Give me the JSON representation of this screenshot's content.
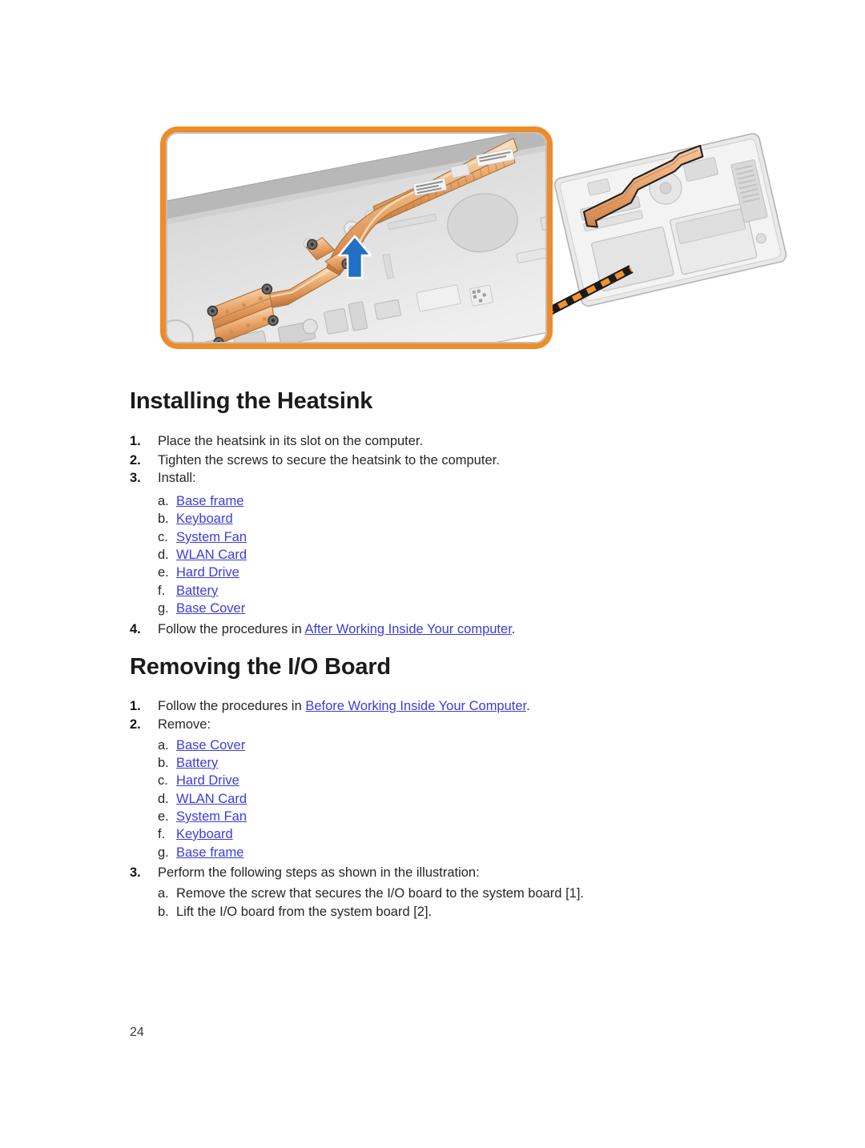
{
  "page": {
    "number": "24"
  },
  "figure": {
    "name": "heatsink-installation-illustration",
    "callout_label": "magnified-heatsink-view",
    "laptop_label": "laptop-base-exploded-view",
    "colors": {
      "callout_border": "#ef8b28",
      "arrow": "#2170c4",
      "heatsink_copper": "#e3a06a",
      "chassis_gray": "#c9c9c9"
    }
  },
  "sections": [
    {
      "heading": "Installing the Heatsink",
      "steps": [
        {
          "marker": "1.",
          "text": "Place the heatsink in its slot on the computer."
        },
        {
          "marker": "2.",
          "text": "Tighten the screws to secure the heatsink to the computer."
        },
        {
          "marker": "3.",
          "text": "Install:"
        }
      ],
      "sub_items": [
        {
          "marker": "a.",
          "text": "Base frame",
          "link": true
        },
        {
          "marker": "b.",
          "text": "Keyboard",
          "link": true
        },
        {
          "marker": "c.",
          "text": "System Fan",
          "link": true
        },
        {
          "marker": "d.",
          "text": "WLAN Card",
          "link": true
        },
        {
          "marker": "e.",
          "text": "Hard Drive",
          "link": true
        },
        {
          "marker": "f.",
          "text": "Battery",
          "link": true
        },
        {
          "marker": "g.",
          "text": "Base Cover",
          "link": true
        }
      ],
      "final_step": {
        "marker": "4.",
        "prefix": "Follow the procedures in ",
        "link_text": "After Working Inside Your computer",
        "suffix": "."
      }
    },
    {
      "heading": "Removing the I/O Board",
      "steps": [
        {
          "marker": "1.",
          "prefix": "Follow the procedures in ",
          "link_text": "Before Working Inside Your Computer",
          "suffix": "."
        },
        {
          "marker": "2.",
          "text": "Remove:"
        }
      ],
      "sub_items": [
        {
          "marker": "a.",
          "text": "Base Cover",
          "link": true
        },
        {
          "marker": "b.",
          "text": "Battery",
          "link": true
        },
        {
          "marker": "c.",
          "text": "Hard Drive",
          "link": true
        },
        {
          "marker": "d.",
          "text": "WLAN Card",
          "link": true
        },
        {
          "marker": "e.",
          "text": "System Fan",
          "link": true
        },
        {
          "marker": "f.",
          "text": "Keyboard",
          "link": true
        },
        {
          "marker": "g.",
          "text": "Base frame",
          "link": true
        }
      ],
      "illustration_step": {
        "marker": "3.",
        "text": "Perform the following steps as shown in the illustration:"
      },
      "illustration_sub_items": [
        {
          "marker": "a.",
          "text": "Remove the screw that secures the I/O board to the system board [1]."
        },
        {
          "marker": "b.",
          "text": "Lift the I/O board from the system board [2]."
        }
      ]
    }
  ]
}
